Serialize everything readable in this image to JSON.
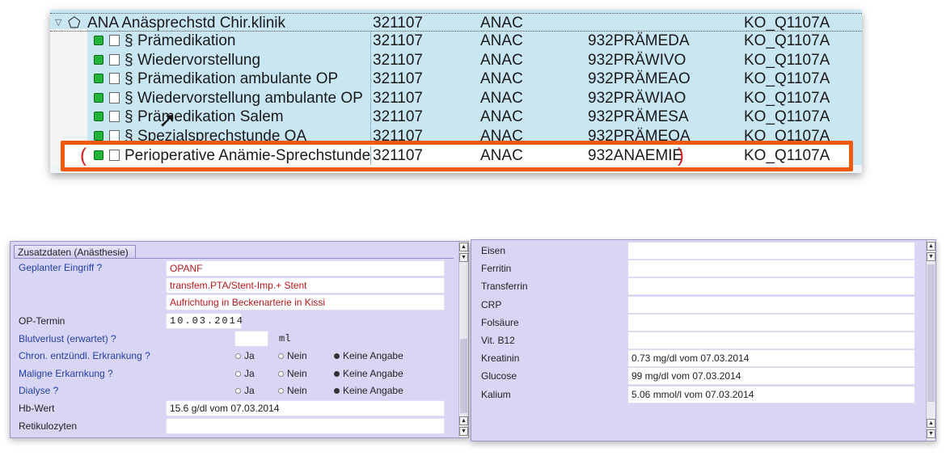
{
  "tree": {
    "header": {
      "icon": "tag-icon",
      "name": "ANA   Anäsprechstd Chir.klinik",
      "num": "321107",
      "code": "ANAC",
      "ko": "KO_Q1107A"
    },
    "rows": [
      {
        "name": "Prämedikation",
        "num": "321107",
        "code": "ANAC",
        "cat": "932PRÄMEDA",
        "ko": "KO_Q1107A"
      },
      {
        "name": "Wiedervorstellung",
        "num": "321107",
        "code": "ANAC",
        "cat": "932PRÄWIVO",
        "ko": "KO_Q1107A"
      },
      {
        "name": "Prämedikation ambulante OP",
        "num": "321107",
        "code": "ANAC",
        "cat": "932PRÄMEAO",
        "ko": "KO_Q1107A"
      },
      {
        "name": "Wiedervorstellung ambulante OP",
        "num": "321107",
        "code": "ANAC",
        "cat": "932PRÄWIAO",
        "ko": "KO_Q1107A"
      },
      {
        "name": "Prämedikation Salem",
        "num": "321107",
        "code": "ANAC",
        "cat": "932PRÄMESA",
        "ko": "KO_Q1107A"
      },
      {
        "name": "Spezialsprechstunde OA",
        "num": "321107",
        "code": "ANAC",
        "cat": "932PRÄMEOA",
        "ko": "KO_Q1107A"
      }
    ],
    "highlighted": {
      "name": "Perioperative Anämie-Sprechstunde",
      "num": "321107",
      "code": "ANAC",
      "cat": "932ANAEMIE",
      "ko": "KO_Q1107A"
    },
    "section_symbol": "§",
    "highlight_color": "#f05a0a"
  },
  "left_panel": {
    "tab_title": "Zusatzdaten (Anästhesie)",
    "geplanter_label": "Geplanter Eingriff ?",
    "geplanter_lines": [
      "OPANF",
      "transfem.PTA/Stent-Imp.+ Stent",
      "Aufrichtung in Beckenarterie in Kissi"
    ],
    "op_termin_label": "OP-Termin",
    "op_termin_value": "10.03.2014",
    "blutverlust_label": "Blutverlust (erwartet) ?",
    "blutverlust_value": "",
    "blutverlust_unit": "ml",
    "questions": [
      {
        "label": "Chron. entzündl. Erkrankung ?",
        "selected": "Keine Angabe"
      },
      {
        "label": "Maligne Erkarnkung ?",
        "selected": "Keine Angabe"
      },
      {
        "label": "Dialyse ?",
        "selected": "Keine Angabe"
      }
    ],
    "options": [
      "Ja",
      "Nein",
      "Keine Angabe"
    ],
    "hb_label": "Hb-Wert",
    "hb_value": "15.6 g/dl vom 07.03.2014",
    "retikulozyten_label": "Retikulozyten",
    "retikulozyten_value": ""
  },
  "right_panel": {
    "rows": [
      {
        "label": "Eisen",
        "value": ""
      },
      {
        "label": "Ferritin",
        "value": ""
      },
      {
        "label": "Transferrin",
        "value": ""
      },
      {
        "label": "CRP",
        "value": ""
      },
      {
        "label": "Folsäure",
        "value": ""
      },
      {
        "label": "Vit. B12",
        "value": ""
      },
      {
        "label": "Kreatinin",
        "value": "0.73 mg/dl vom 07.03.2014"
      },
      {
        "label": "Glucose",
        "value": "99 mg/dl vom 07.03.2014"
      },
      {
        "label": "Kalium",
        "value": "5.06 mmol/l vom 07.03.2014"
      }
    ]
  }
}
